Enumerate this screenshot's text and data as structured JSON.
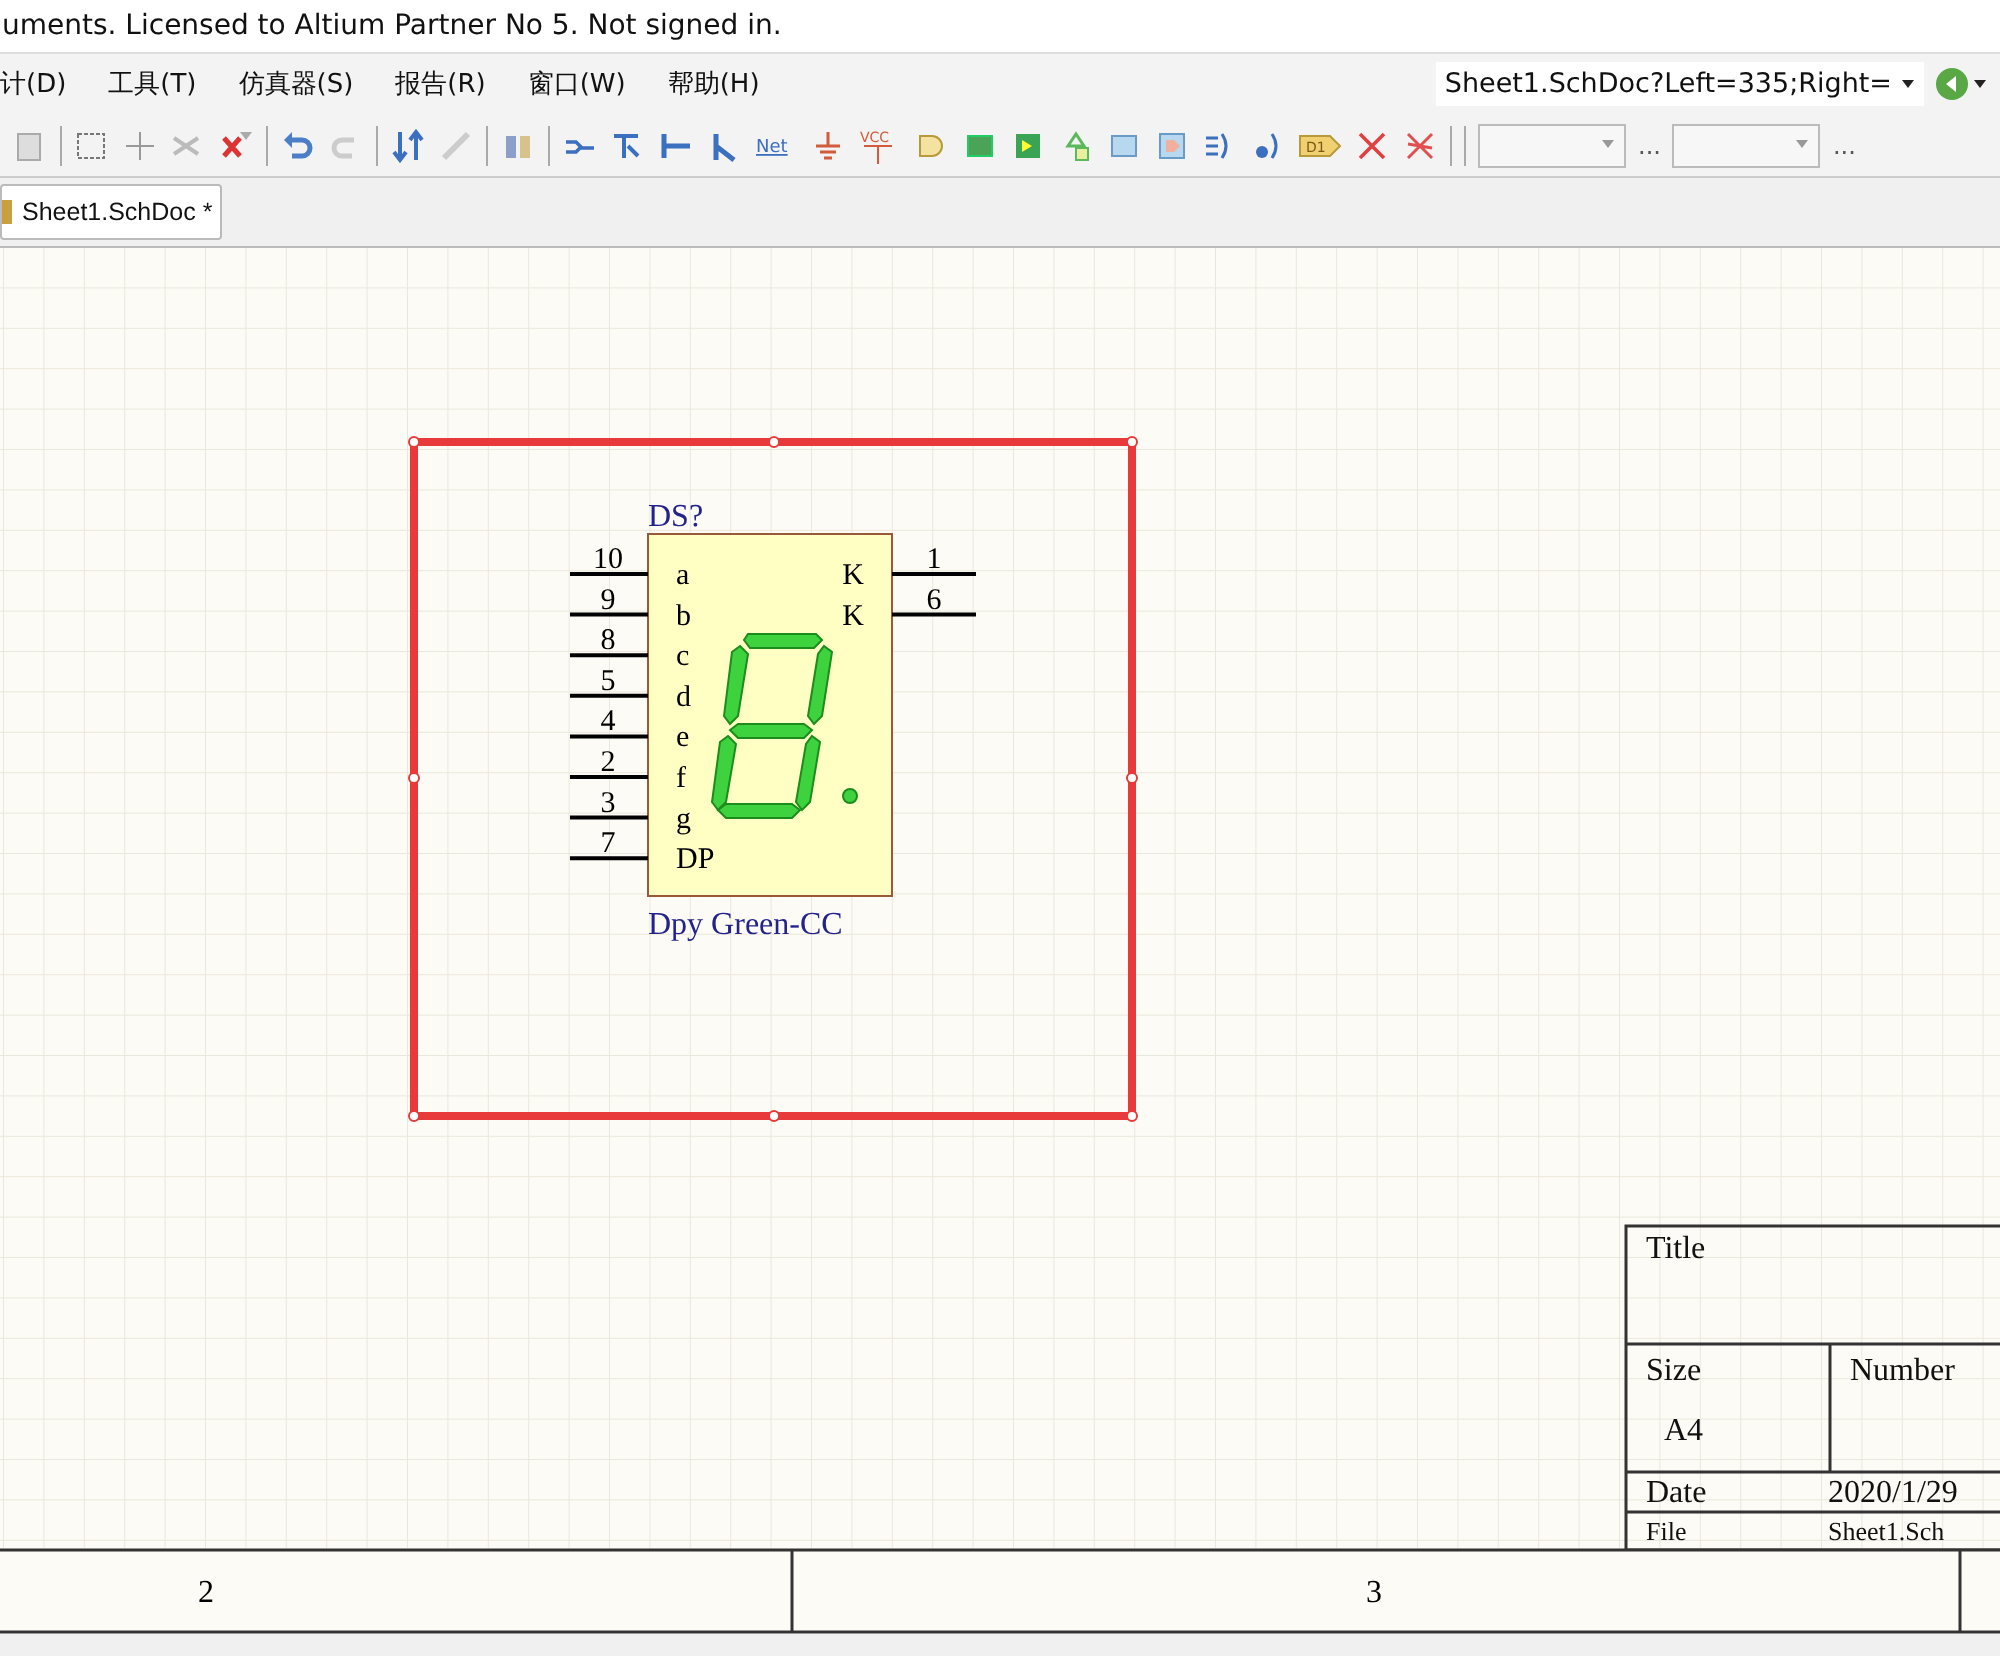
{
  "window": {
    "title": "uments. Licensed to Altium Partner No 5. Not signed in."
  },
  "menu": [
    {
      "label": "计(D)"
    },
    {
      "label": "工具(T)"
    },
    {
      "label": "仿真器(S)"
    },
    {
      "label": "报告(R)"
    },
    {
      "label": "窗口(W)"
    },
    {
      "label": "帮助(H)"
    }
  ],
  "address_bar": {
    "value": "Sheet1.SchDoc?Left=335;Right="
  },
  "toolbar": {
    "net_text": "Net",
    "vcc_text": "VCC",
    "port_text": "D1",
    "ellipses": [
      "...",
      "..."
    ]
  },
  "tabs": [
    {
      "label": "Sheet1.SchDoc *",
      "selected": true
    }
  ],
  "schematic": {
    "selected": true,
    "designator": "DS?",
    "comment": "Dpy Green-CC",
    "left_pins": [
      {
        "number": "10",
        "name": "a"
      },
      {
        "number": "9",
        "name": "b"
      },
      {
        "number": "8",
        "name": "c"
      },
      {
        "number": "5",
        "name": "d"
      },
      {
        "number": "4",
        "name": "e"
      },
      {
        "number": "2",
        "name": "f"
      },
      {
        "number": "3",
        "name": "g"
      },
      {
        "number": "7",
        "name": "DP"
      }
    ],
    "right_pins": [
      {
        "number": "1",
        "name": "K"
      },
      {
        "number": "6",
        "name": "K"
      }
    ]
  },
  "title_block": {
    "title_label": "Title",
    "size_label": "Size",
    "size": "A4",
    "number_label": "Number",
    "date_label": "Date",
    "date": "2020/1/29",
    "file_label": "File",
    "file": "Sheet1.Sch"
  },
  "border": {
    "zones": [
      "2",
      "3"
    ]
  }
}
